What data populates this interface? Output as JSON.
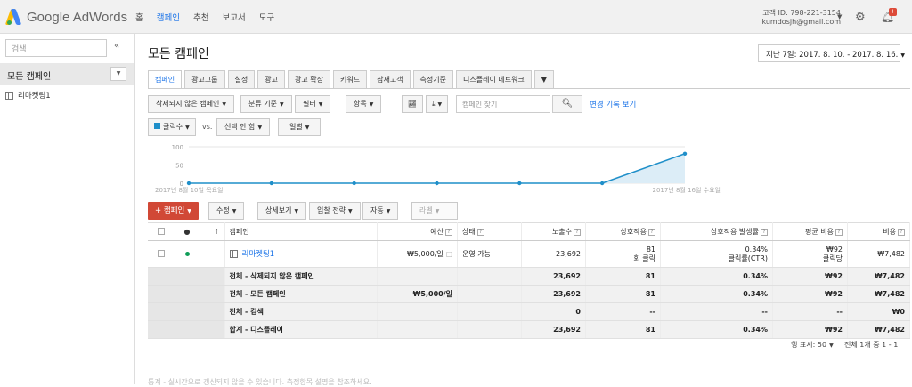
{
  "app": {
    "logo_text": "Google AdWords"
  },
  "topnav": [
    "홈",
    "캠페인",
    "추천",
    "보고서",
    "도구"
  ],
  "account": {
    "id_line": "고객 ID: 798-221-3154",
    "email": "kumdosjh@gmail.com",
    "badge": "!"
  },
  "sidebar": {
    "search_placeholder": "검색",
    "collapse": "«",
    "all_campaigns": "모든 캠페인",
    "campaign": "리마켓팅1"
  },
  "main": {
    "title": "모든 캠페인",
    "date_range": "지난 7일: 2017. 8. 10. - 2017. 8. 16."
  },
  "tabs": [
    "캠페인",
    "광고그룹",
    "설정",
    "광고",
    "광고 확장",
    "키워드",
    "잠재고객",
    "측정기준",
    "디스플레이 네트워크"
  ],
  "toolbar": {
    "status_filter": "삭제되지 않은 캠페인",
    "segment": "분류 기준",
    "filter": "필터",
    "columns": "항목",
    "search_placeholder": "캠페인 찾기",
    "history_link": "변경 기록 보기",
    "metric1": "클릭수",
    "vs": "vs.",
    "metric2": "선택 안 함",
    "period": "일별"
  },
  "chart_data": {
    "type": "line",
    "y_ticks": [
      "100",
      "50",
      "0"
    ],
    "ylim": [
      0,
      100
    ],
    "start_label": "2017년 8월 10일 목요일",
    "end_label": "2017년 8월 16일 수요일",
    "values": [
      0,
      0,
      0,
      0,
      0,
      0,
      81
    ],
    "color": "#1f8fc9"
  },
  "actions": {
    "add_campaign": "+ 캠페인",
    "edit": "수정",
    "details": "상세보기",
    "bid_strategy": "입찰 전략",
    "automate": "자동",
    "label": "라벨"
  },
  "table": {
    "headers": [
      "캠페인",
      "예산",
      "상태",
      "노출수",
      "상호작용",
      "상호작용 발생률",
      "평균 비용",
      "비용"
    ],
    "row": {
      "name": "리마켓팅1",
      "budget": "₩5,000/일",
      "status": "운영 가능",
      "impr": "23,692",
      "inter": "81",
      "inter_sub": "회 클릭",
      "rate": "0.34%",
      "rate_sub": "클릭률(CTR)",
      "avg": "₩92",
      "avg_sub": "클릭당",
      "cost": "₩7,482"
    },
    "totals": [
      {
        "label": "전체 - 삭제되지 않은 캠페인",
        "budget": "",
        "impr": "23,692",
        "inter": "81",
        "rate": "0.34%",
        "avg": "₩92",
        "cost": "₩7,482"
      },
      {
        "label": "전체 - 모든 캠페인",
        "budget": "₩5,000/일",
        "impr": "23,692",
        "inter": "81",
        "rate": "0.34%",
        "avg": "₩92",
        "cost": "₩7,482"
      },
      {
        "label": "전체 - 검색",
        "budget": "",
        "impr": "0",
        "inter": "--",
        "rate": "--",
        "avg": "--",
        "cost": "₩0"
      },
      {
        "label": "합계 - 디스플레이",
        "budget": "",
        "impr": "23,692",
        "inter": "81",
        "rate": "0.34%",
        "avg": "₩92",
        "cost": "₩7,482"
      }
    ]
  },
  "pager": {
    "rows_label": "행 표시:",
    "rows": "50",
    "summary": "전체 1개 중 1 - 1"
  },
  "footer": "통계 - 실시간으로 갱신되지 않을 수 있습니다. 측정항목 설명을 참조하세요."
}
